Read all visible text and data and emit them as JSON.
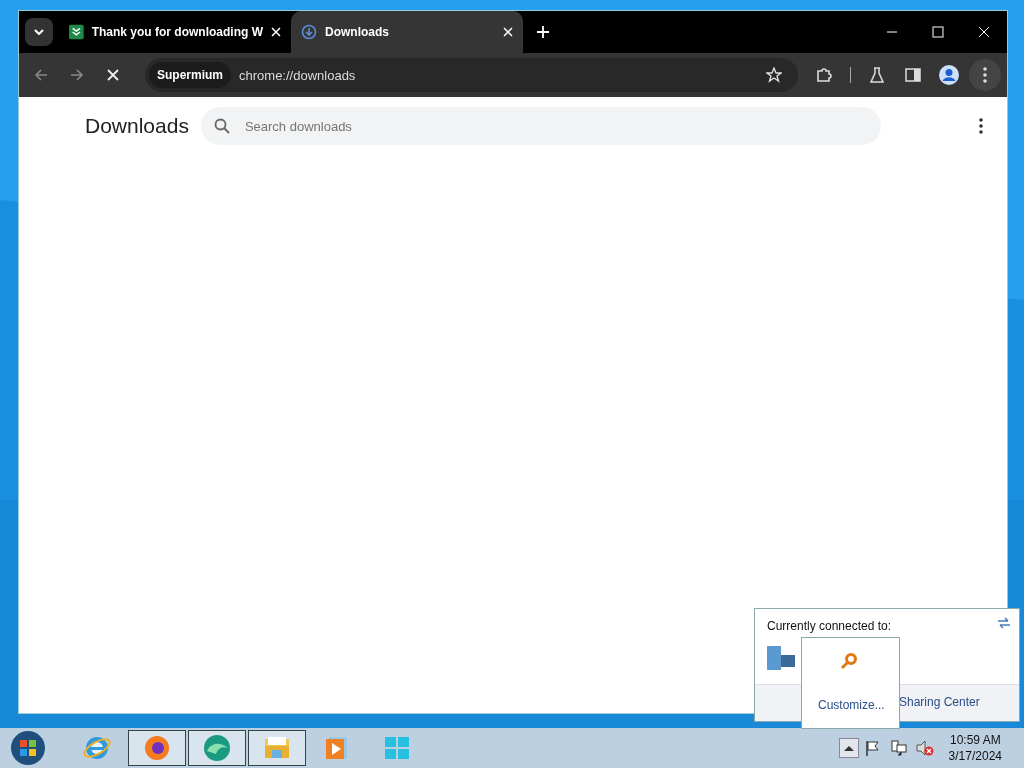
{
  "browser": {
    "tabs": [
      {
        "title": "Thank you for downloading W",
        "selected": false
      },
      {
        "title": "Downloads",
        "selected": true
      }
    ],
    "brand_chip": "Supermium",
    "address": "chrome://downloads",
    "page": {
      "title": "Downloads",
      "search": {
        "placeholder": "Search downloads"
      }
    }
  },
  "network_popup": {
    "heading": "Currently connected to:",
    "link": "Sharing Center"
  },
  "tray_overflow": {
    "link": "Customize..."
  },
  "taskbar": {
    "apps": [
      {
        "kind": "ie",
        "running": false
      },
      {
        "kind": "firefox",
        "running": true
      },
      {
        "kind": "globe",
        "running": true
      },
      {
        "kind": "explorer",
        "running": true
      },
      {
        "kind": "media",
        "running": false
      },
      {
        "kind": "windows",
        "running": false
      }
    ],
    "time": "10:59 AM",
    "date": "3/17/2024"
  }
}
